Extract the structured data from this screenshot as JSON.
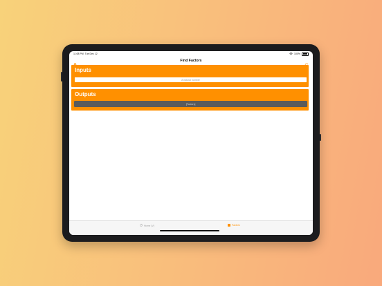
{
  "status": {
    "time": "11:08 PM",
    "date": "Tue Dec 12",
    "battery": "100%"
  },
  "nav": {
    "title": "Find Factors"
  },
  "inputs": {
    "title": "Inputs",
    "placeholder": "A natural number"
  },
  "outputs": {
    "title": "Outputs",
    "value": "[Factors]"
  },
  "tabs": [
    {
      "label": "Home (V)",
      "active": false
    },
    {
      "label": "Factors",
      "active": true
    }
  ],
  "colors": {
    "accent": "#ff9000",
    "output_bg": "#5b5b5b"
  },
  "icons": {
    "nav_left": "lock-icon",
    "nav_right": "refresh-icon",
    "tab_home": "gauge-icon",
    "tab_factors": "square-icon"
  }
}
